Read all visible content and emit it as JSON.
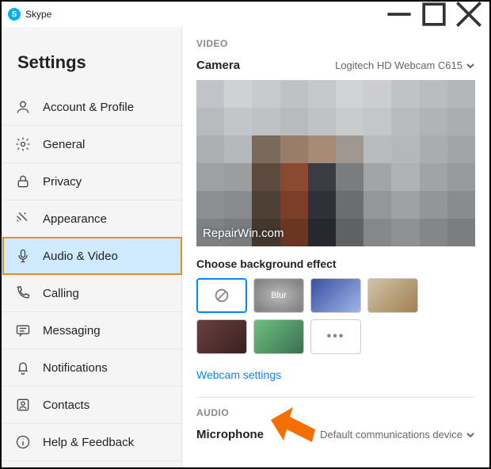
{
  "window": {
    "app_name": "Skype"
  },
  "sidebar": {
    "title": "Settings",
    "items": [
      {
        "label": "Account & Profile"
      },
      {
        "label": "General"
      },
      {
        "label": "Privacy"
      },
      {
        "label": "Appearance"
      },
      {
        "label": "Audio & Video"
      },
      {
        "label": "Calling"
      },
      {
        "label": "Messaging"
      },
      {
        "label": "Notifications"
      },
      {
        "label": "Contacts"
      },
      {
        "label": "Help & Feedback"
      }
    ]
  },
  "main": {
    "video_section": "VIDEO",
    "camera_label": "Camera",
    "camera_device": "Logitech HD Webcam C615",
    "watermark": "RepairWin.com",
    "background_label": "Choose background effect",
    "blur_label": "Blur",
    "more_label": "•••",
    "webcam_settings": "Webcam settings",
    "audio_section": "AUDIO",
    "microphone_label": "Microphone",
    "microphone_device": "Default communications device"
  }
}
